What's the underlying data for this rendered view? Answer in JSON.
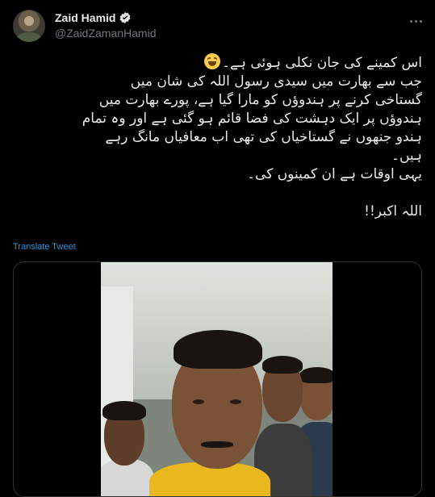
{
  "author": {
    "name": "Zaid Hamid",
    "handle": "@ZaidZamanHamid"
  },
  "tweet": {
    "lines": [
      "اس کمینے کی جان نکلی ہوئی ہے۔",
      "جب سے بھارت میں سیدی رسول اللہ کی شان میں",
      "گستاخی کرنے پر ہندوؤں کو مارا گیا ہے، پورے بھارت میں",
      "ہندوؤں پر ایک دہشت کی فضا قائم ہو گئی ہے اور وہ تمام",
      "ہندو جنھوں نے گستاخیاں کی تھی اب معافیاں مانگ رہے",
      "ہیں۔",
      "یہی اوقات ہے ان کمینوں کی۔",
      "",
      "اللہ اکبر!!"
    ],
    "emoji": "rolling-on-floor-laughing-emoji"
  },
  "translate_label": "Translate Tweet",
  "icons": {
    "verified": "verified-badge-icon",
    "more": "more-options-icon"
  },
  "colors": {
    "background": "#000000",
    "text": "#e7e9ea",
    "secondary": "#71767b",
    "link": "#1d9bf0",
    "border": "#2f3336"
  }
}
